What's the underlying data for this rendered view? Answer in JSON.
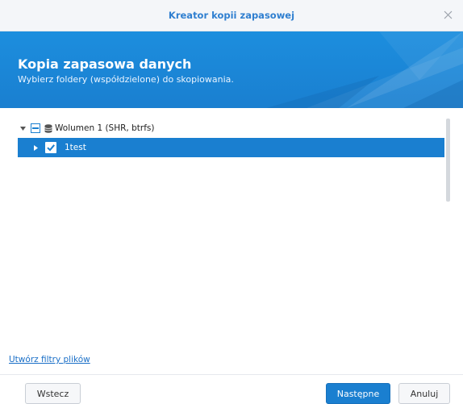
{
  "window": {
    "title": "Kreator kopii zapasowej"
  },
  "banner": {
    "title": "Kopia zapasowa danych",
    "subtitle": "Wybierz foldery (współdzielone) do skopiowania."
  },
  "tree": {
    "volume": {
      "label": "Wolumen 1 (SHR, btrfs)",
      "state": "partial",
      "expanded": true,
      "icon": "database-icon"
    },
    "folders": [
      {
        "label": "1test",
        "checked": true,
        "selected": true,
        "expanded": false
      }
    ]
  },
  "footer": {
    "filter_link": "Utwórz filtry plików",
    "back_label": "Wstecz",
    "next_label": "Następne",
    "cancel_label": "Anuluj"
  },
  "colors": {
    "accent": "#1a7fd0",
    "title_text": "#2f7fd0",
    "link": "#1a6fc7"
  }
}
